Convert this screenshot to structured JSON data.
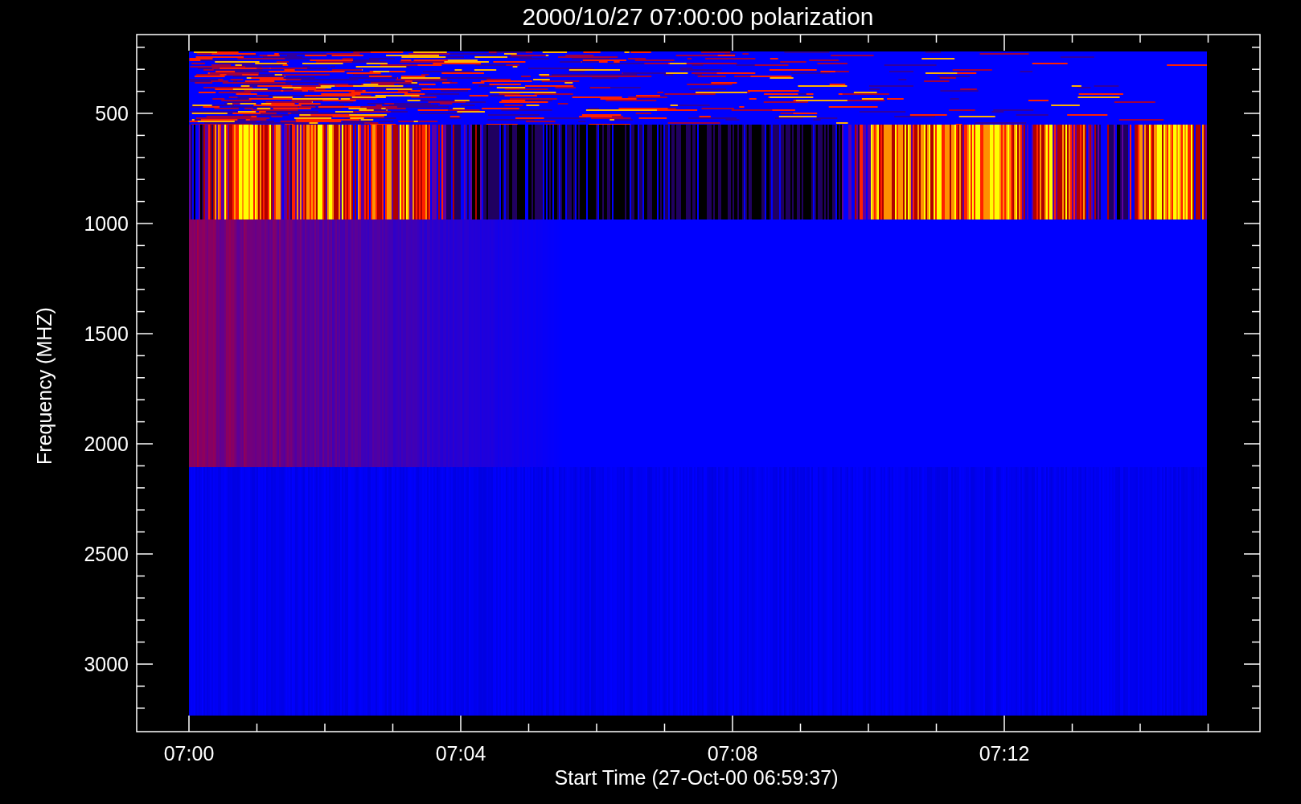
{
  "plot": {
    "title": "2000/10/27 07:00:00 polarization",
    "xlabel": "Start Time (27-Oct-00 06:59:37)",
    "ylabel": "Frequency (MHZ)",
    "xtick_labels": [
      "07:00",
      "07:04",
      "07:08",
      "07:12"
    ],
    "ytick_labels": [
      "500",
      "1000",
      "1500",
      "2000",
      "2500",
      "3000"
    ]
  }
}
